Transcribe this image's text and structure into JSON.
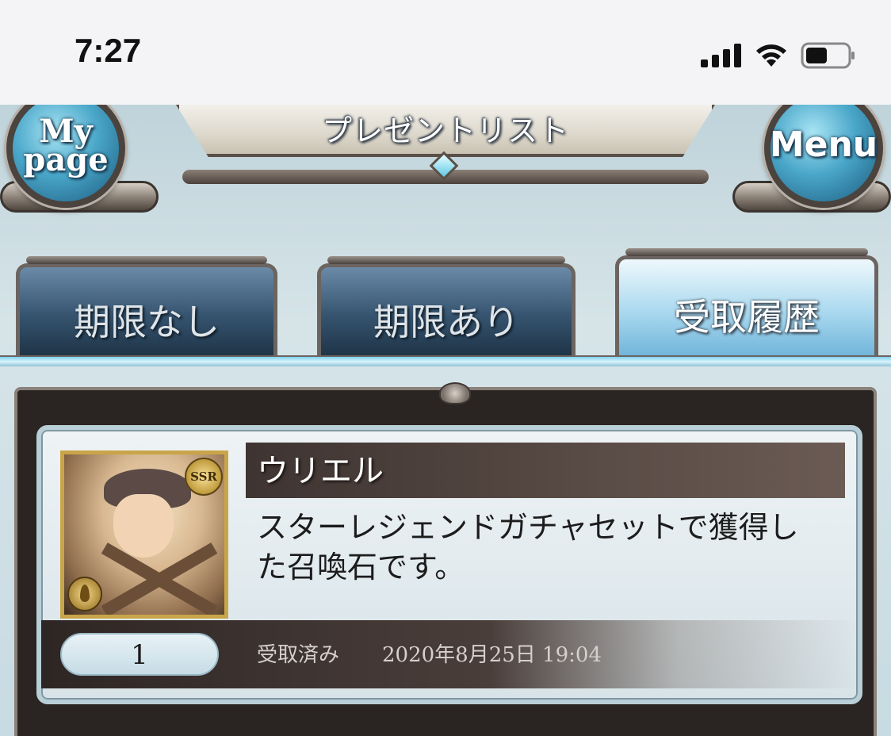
{
  "status_bar": {
    "time": "7:27"
  },
  "header": {
    "title": "プレゼントリスト",
    "mypage_line1": "My",
    "mypage_line2": "page",
    "menu_label": "Menu"
  },
  "tabs": [
    {
      "label": "期限なし",
      "active": false
    },
    {
      "label": "期限あり",
      "active": false
    },
    {
      "label": "受取履歴",
      "active": true
    }
  ],
  "items": [
    {
      "name": "ウリエル",
      "description": "スターレジェンドガチャセットで獲得した召喚石です。",
      "rarity": "SSR",
      "quantity": "1",
      "status": "受取済み",
      "received_at": "2020年8月25日 19:04"
    }
  ],
  "colors": {
    "accent": "#6fb4d9",
    "panel_dark": "#2a2422"
  }
}
